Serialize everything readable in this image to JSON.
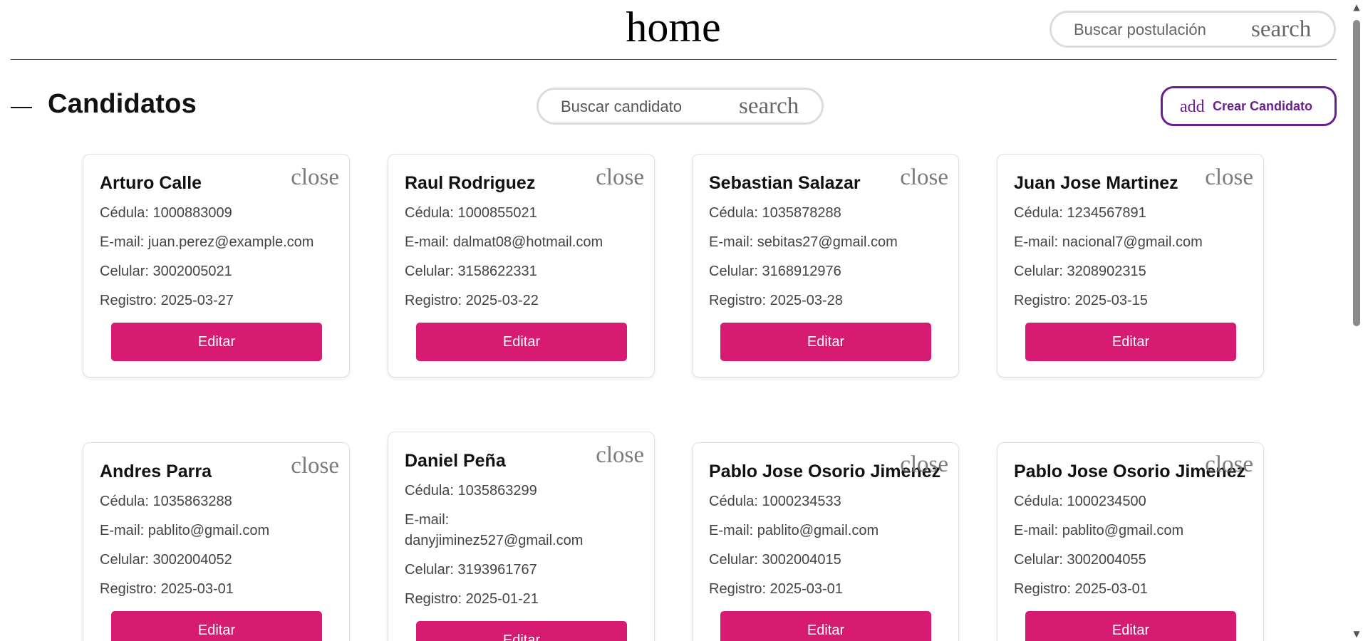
{
  "header": {
    "title": "home",
    "search_placeholder": "Buscar postulación",
    "search_icon": "search"
  },
  "section": {
    "title": "Candidatos",
    "search_placeholder": "Buscar candidato",
    "search_icon": "search",
    "create_icon": "add",
    "create_label": "Crear Candidato"
  },
  "cards": [
    {
      "name": "Arturo Calle",
      "close": "close",
      "cedula": "Cédula: 1000883009",
      "email": "E-mail: juan.perez@example.com",
      "email_label": "",
      "email_value": "",
      "celular": "Celular: 3002005021",
      "registro": "Registro: 2025-03-27",
      "edit": "Editar"
    },
    {
      "name": "Raul Rodriguez",
      "close": "close",
      "cedula": "Cédula: 1000855021",
      "email": "E-mail: dalmat08@hotmail.com",
      "email_label": "",
      "email_value": "",
      "celular": "Celular: 3158622331",
      "registro": "Registro: 2025-03-22",
      "edit": "Editar"
    },
    {
      "name": "Sebastian Salazar",
      "close": "close",
      "cedula": "Cédula: 1035878288",
      "email": "E-mail: sebitas27@gmail.com",
      "email_label": "",
      "email_value": "",
      "celular": "Celular: 3168912976",
      "registro": "Registro: 2025-03-28",
      "edit": "Editar"
    },
    {
      "name": "Juan Jose Martinez",
      "close": "close",
      "cedula": "Cédula: 1234567891",
      "email": "E-mail: nacional7@gmail.com",
      "email_label": "",
      "email_value": "",
      "celular": "Celular: 3208902315",
      "registro": "Registro: 2025-03-15",
      "edit": "Editar"
    },
    {
      "name": "Andres Parra",
      "close": "close",
      "cedula": "Cédula: 1035863288",
      "email": "E-mail: pablito@gmail.com",
      "email_label": "",
      "email_value": "",
      "celular": "Celular: 3002004052",
      "registro": "Registro: 2025-03-01",
      "edit": "Editar"
    },
    {
      "name": "Daniel Peña",
      "close": "close",
      "cedula": "Cédula: 1035863299",
      "email": "",
      "email_label": "E-mail:",
      "email_value": "danyjiminez527@gmail.com",
      "celular": "Celular: 3193961767",
      "registro": "Registro: 2025-01-21",
      "edit": "Editar"
    },
    {
      "name": "Pablo Jose Osorio Jimenez",
      "close": "close",
      "cedula": "Cédula: 1000234533",
      "email": "E-mail: pablito@gmail.com",
      "email_label": "",
      "email_value": "",
      "celular": "Celular: 3002004015",
      "registro": "Registro: 2025-03-01",
      "edit": "Editar"
    },
    {
      "name": "Pablo Jose Osorio Jimenez",
      "close": "close",
      "cedula": "Cédula: 1000234500",
      "email": "E-mail: pablito@gmail.com",
      "email_label": "",
      "email_value": "",
      "celular": "Celular: 3002004055",
      "registro": "Registro: 2025-03-01",
      "edit": "Editar"
    }
  ]
}
